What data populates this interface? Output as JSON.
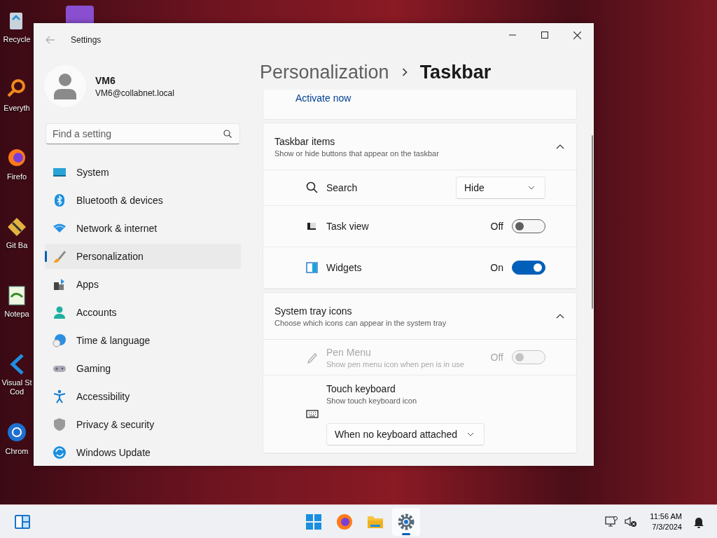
{
  "desktop": {
    "icons": [
      {
        "label": "Recycle"
      },
      {
        "label": "Everyth"
      },
      {
        "label": "Firefo"
      },
      {
        "label": "Git Ba"
      },
      {
        "label": "Notepa"
      },
      {
        "label": "Visual St\nCod"
      },
      {
        "label": "Chrom"
      }
    ]
  },
  "window": {
    "title": "Settings"
  },
  "profile": {
    "name": "VM6",
    "email": "VM6@collabnet.local"
  },
  "search": {
    "placeholder": "Find a setting"
  },
  "nav": [
    {
      "label": "System",
      "selected": false
    },
    {
      "label": "Bluetooth & devices",
      "selected": false
    },
    {
      "label": "Network & internet",
      "selected": false
    },
    {
      "label": "Personalization",
      "selected": true
    },
    {
      "label": "Apps",
      "selected": false
    },
    {
      "label": "Accounts",
      "selected": false
    },
    {
      "label": "Time & language",
      "selected": false
    },
    {
      "label": "Gaming",
      "selected": false
    },
    {
      "label": "Accessibility",
      "selected": false
    },
    {
      "label": "Privacy & security",
      "selected": false
    },
    {
      "label": "Windows Update",
      "selected": false
    }
  ],
  "breadcrumb": {
    "parent": "Personalization",
    "current": "Taskbar"
  },
  "activation": {
    "link": "Activate now"
  },
  "sections": [
    {
      "title": "Taskbar items",
      "subtitle": "Show or hide buttons that appear on the taskbar",
      "expanded": true,
      "rows": [
        {
          "kind": "dropdown",
          "label": "Search",
          "value": "Hide",
          "disabled": false
        },
        {
          "kind": "toggle",
          "label": "Task view",
          "state_text": "Off",
          "on": false,
          "disabled": false
        },
        {
          "kind": "toggle",
          "label": "Widgets",
          "state_text": "On",
          "on": true,
          "disabled": false
        }
      ]
    },
    {
      "title": "System tray icons",
      "subtitle": "Choose which icons can appear in the system tray",
      "expanded": true,
      "rows": [
        {
          "kind": "toggle",
          "label": "Pen Menu",
          "description": "Show pen menu icon when pen is in use",
          "state_text": "Off",
          "on": false,
          "disabled": true
        },
        {
          "kind": "dropdown_below",
          "label": "Touch keyboard",
          "description": "Show touch keyboard icon",
          "value": "When no keyboard attached",
          "disabled": false
        }
      ]
    }
  ],
  "taskbar": {
    "apps": [
      {
        "selected": false
      },
      {
        "selected": false
      },
      {
        "selected": false
      },
      {
        "selected": true
      }
    ],
    "time": "11:56 AM",
    "date": "7/3/2024"
  }
}
